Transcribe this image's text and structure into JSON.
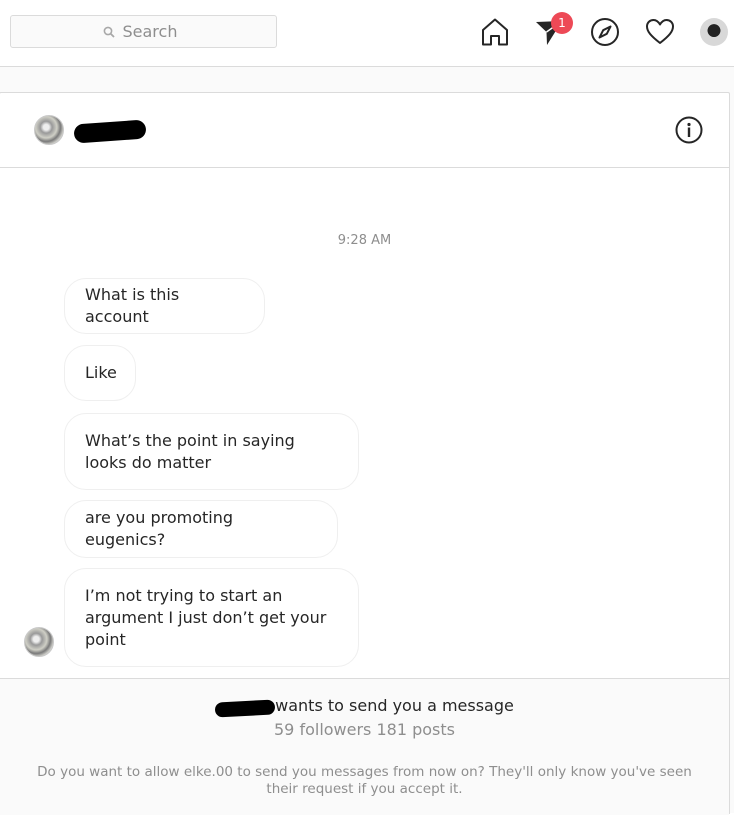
{
  "search": {
    "placeholder": "Search"
  },
  "nav": {
    "icons": [
      "home-icon",
      "direct-icon",
      "explore-icon",
      "activity-heart-icon",
      "profile-avatar"
    ],
    "notification_count": "1",
    "badge_color": "#ed4956"
  },
  "thread": {
    "timestamp": "9:28 AM",
    "messages": [
      "What is this account",
      "Like",
      "What’s the point in saying looks do matter",
      "are you promoting eugenics?",
      "I’m not trying to start an argument I just don’t get your point"
    ]
  },
  "request": {
    "wants_text": "wants to send you a message",
    "stats": "59 followers 181 posts",
    "question": "Do you want to allow elke.00 to send you messages from now on? They'll only know you've seen their request if you accept it."
  }
}
